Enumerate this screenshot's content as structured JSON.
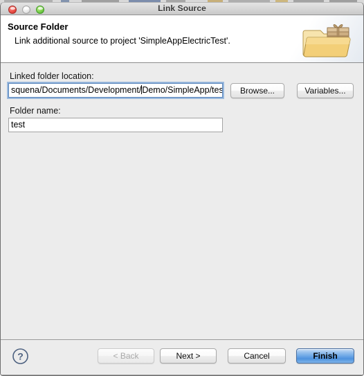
{
  "window": {
    "title": "Link Source",
    "traffic_lights": [
      {
        "name": "close-button",
        "label": "Close",
        "color": "#e8473f"
      },
      {
        "name": "minimize-button",
        "label": "Minimize",
        "color": "#e6e6e6"
      },
      {
        "name": "zoom-button",
        "label": "Zoom",
        "color": "#73cc45"
      }
    ]
  },
  "header": {
    "title": "Source Folder",
    "subtitle": "Link additional source to project 'SimpleAppElectricTest'.",
    "icon": "folder-with-package-icon"
  },
  "body": {
    "location": {
      "label": "Linked folder location:",
      "value_before_caret": "squena/Documents/Development/",
      "value_after_caret": "Demo/SimpleApp/test",
      "full_value": "squena/Documents/Development/Demo/SimpleApp/test",
      "placeholder": "",
      "focused": true
    },
    "folder_name": {
      "label": "Folder name:",
      "value": "test",
      "placeholder": ""
    },
    "browse_label": "Browse...",
    "variables_label": "Variables..."
  },
  "footer": {
    "help_label": "?",
    "back_label": "< Back",
    "next_label": "Next >",
    "cancel_label": "Cancel",
    "finish_label": "Finish",
    "back_disabled": true,
    "default_button": "Finish"
  },
  "colors": {
    "window_bg": "#ececec",
    "header_bg": "#ffffff",
    "focus_ring": "#74a0d4",
    "default_button": "#6aa6e6",
    "help_icon": "#4d6180"
  }
}
